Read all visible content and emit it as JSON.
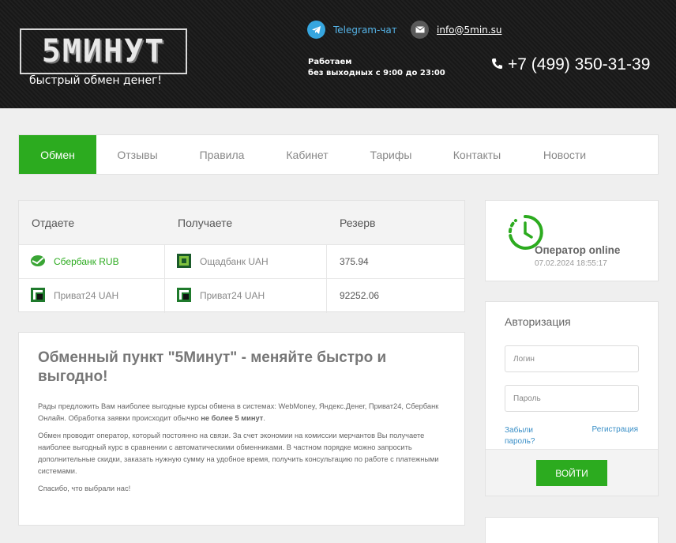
{
  "header": {
    "logo_text": "5МИНУТ",
    "logo_subtitle": "быстрый обмен денег!",
    "telegram_label": "Telegram-чат",
    "email": "info@5min.su",
    "hours_line1": "Работаем",
    "hours_line2": "без выходных с 9:00 до 23:00",
    "phone": "+7 (499) 350-31-39"
  },
  "nav": {
    "items": [
      {
        "label": "Обмен",
        "active": true
      },
      {
        "label": "Отзывы"
      },
      {
        "label": "Правила"
      },
      {
        "label": "Кабинет"
      },
      {
        "label": "Тарифы"
      },
      {
        "label": "Контакты"
      },
      {
        "label": "Новости"
      }
    ]
  },
  "exchange_table": {
    "headers": [
      "Отдаете",
      "Получаете",
      "Резерв"
    ],
    "rows": [
      {
        "give": "Сбербанк RUB",
        "receive": "Ощадбанк UAH",
        "reserve": "375.94"
      },
      {
        "give": "Приват24 UAH",
        "receive": "Приват24 UAH",
        "reserve": "92252.06"
      }
    ]
  },
  "article": {
    "title": "Обменный пункт \"5Минут\" - меняйте быстро и выгодно!",
    "p1_text": "Рады предложить Вам наиболее выгодные курсы обмена в системах: WebMoney, Яндекс.Денег, Приват24, Сбербанк Онлайн. Обработка заявки происходит обычно ",
    "p1_bold": "не более 5 минут",
    "p1_end": ".",
    "p2": "Обмен проводит оператор, который постоянно на связи. За счет экономии на комиссии мерчантов Вы получаете наиболее выгодный курс в сравнении с автоматическими обменниками. В частном порядке можно запросить дополнительные скидки, заказать нужную сумму на удобное время, получить консультацию по работе с платежными системами.",
    "p3": "Спасибо, что выбрали нас!"
  },
  "operator": {
    "title": "Оператор online",
    "time": "07.02.2024 18:55:17"
  },
  "auth": {
    "title": "Авторизация",
    "login_placeholder": "Логин",
    "password_placeholder": "Пароль",
    "forgot_label": "Забыли пароль?",
    "register_label": "Регистрация",
    "submit_label": "ВОЙТИ"
  },
  "colors": {
    "accent_green": "#2cab1f",
    "link_blue": "#3a8fc7",
    "telegram_blue": "#36a6df"
  }
}
